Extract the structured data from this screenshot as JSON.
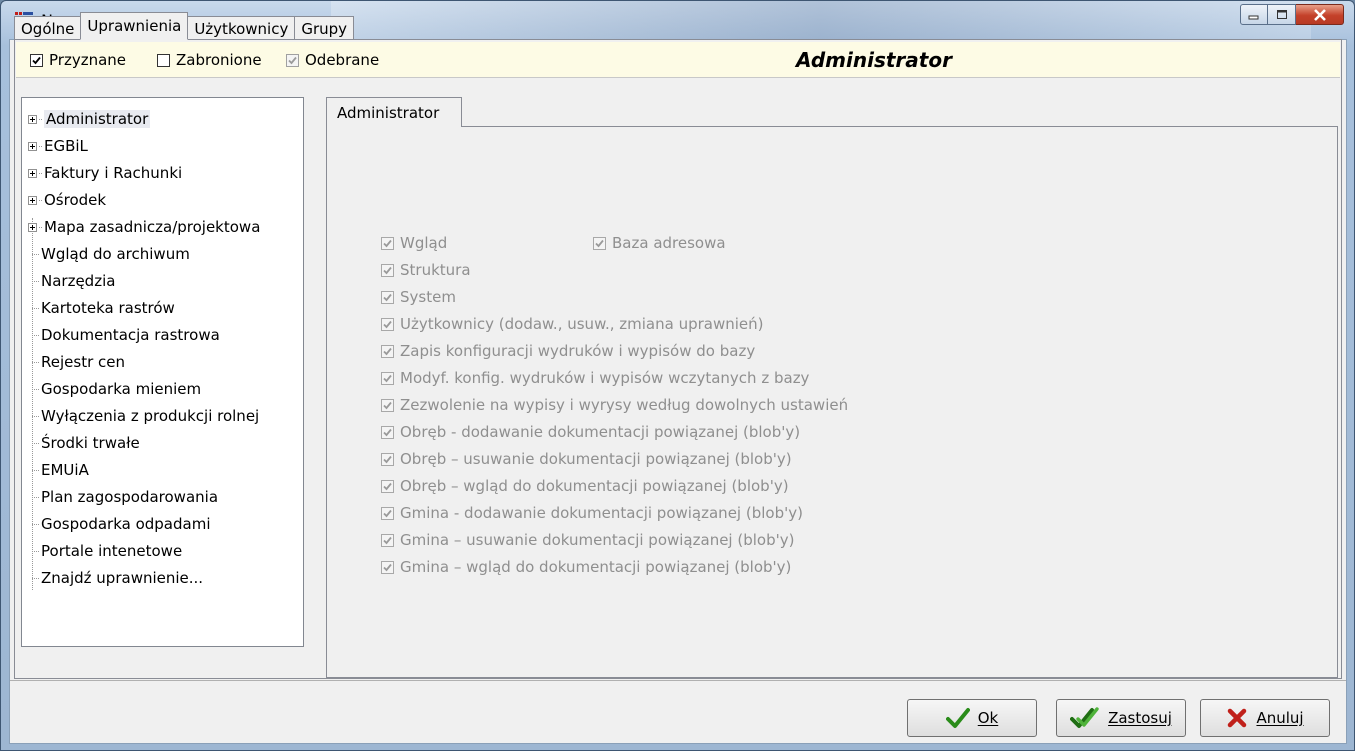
{
  "window": {
    "title": "Nowa rola"
  },
  "tabs": [
    "Ogólne",
    "Uprawnienia",
    "Użytkownicy",
    "Grupy"
  ],
  "active_tab": "Uprawnienia",
  "legend": {
    "granted": "Przyznane",
    "forbidden": "Zabronione",
    "revoked": "Odebrane"
  },
  "role_title": "Administrator",
  "tree": {
    "items": [
      {
        "label": "Administrator",
        "expandable": true,
        "selected": true
      },
      {
        "label": "EGBiL",
        "expandable": true
      },
      {
        "label": "Faktury i Rachunki",
        "expandable": true
      },
      {
        "label": "Ośrodek",
        "expandable": true
      },
      {
        "label": "Mapa zasadnicza/projektowa",
        "expandable": true
      },
      {
        "label": "Wgląd do archiwum",
        "expandable": false
      },
      {
        "label": "Narzędzia",
        "expandable": false
      },
      {
        "label": "Kartoteka rastrów",
        "expandable": false
      },
      {
        "label": "Dokumentacja rastrowa",
        "expandable": false
      },
      {
        "label": "Rejestr cen",
        "expandable": false
      },
      {
        "label": "Gospodarka mieniem",
        "expandable": false
      },
      {
        "label": "Wyłączenia z produkcji rolnej",
        "expandable": false
      },
      {
        "label": "Środki trwałe",
        "expandable": false
      },
      {
        "label": "EMUiA",
        "expandable": false
      },
      {
        "label": "Plan zagospodarowania",
        "expandable": false
      },
      {
        "label": "Gospodarka odpadami",
        "expandable": false
      },
      {
        "label": "Portale intenetowe",
        "expandable": false
      },
      {
        "label": "Znajdź uprawnienie...",
        "expandable": false
      }
    ]
  },
  "inner_tab": "Administrator",
  "permissions_col1": [
    "Wgląd",
    "Struktura",
    "System",
    "Użytkownicy (dodaw., usuw., zmiana uprawnień)",
    "Zapis konfiguracji wydruków i wypisów do bazy",
    "Modyf. konfig. wydruków i wypisów wczytanych z bazy",
    "Zezwolenie na wypisy i wyrysy według dowolnych ustawień",
    "Obręb - dodawanie dokumentacji powiązanej (blob'y)",
    "Obręb – usuwanie dokumentacji powiązanej (blob'y)",
    "Obręb – wgląd do dokumentacji powiązanej (blob'y)",
    "Gmina - dodawanie dokumentacji powiązanej (blob'y)",
    "Gmina – usuwanie dokumentacji powiązanej (blob'y)",
    "Gmina – wgląd do dokumentacji powiązanej (blob'y)"
  ],
  "permissions_col2": [
    "Baza adresowa"
  ],
  "buttons": {
    "ok": "Ok",
    "apply": "Zastosuj",
    "cancel": "Anuluj"
  },
  "colors": {
    "role_bar_bg": "#fdfbe5",
    "ok_check": "#2a8c1a",
    "cancel_x": "#c0201a",
    "disabled_text": "#8f8f8f"
  }
}
